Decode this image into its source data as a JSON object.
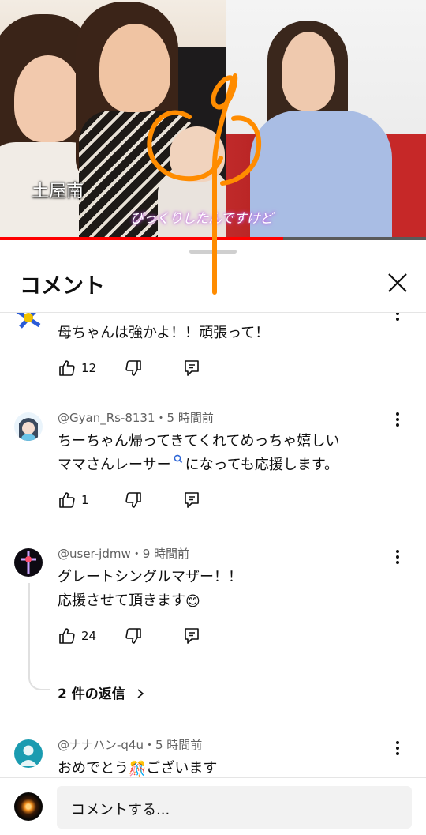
{
  "video": {
    "caption_name": "土屋南",
    "caption_sub": "びっくりしたんですけど",
    "progress": 0.665
  },
  "sheet": {
    "title": "コメント",
    "close_icon": "close-icon",
    "handle": "drag-handle"
  },
  "comments": [
    {
      "author": "",
      "text_lines": [
        "母ちゃんは強かよ！！頑張って！"
      ],
      "likes": "12",
      "avatar_icon": "flag-avatar",
      "partial": true
    },
    {
      "author": "@Gyan_Rs-8131・5 時間前",
      "text_lines": [
        "ちーちゃん帰ってきてくれてめっちゃ嬉しい",
        "ママさんレーサー",
        "になっても応援します。"
      ],
      "search_link_icon": "search-icon",
      "likes": "1",
      "avatar_icon": "anime-character-avatar"
    },
    {
      "author": "@user-jdmw・9 時間前",
      "text_lines": [
        "グレートシングルマザー！！",
        "応援させて頂きます"
      ],
      "emoji": "😊",
      "likes": "24",
      "avatar_icon": "cross-avatar",
      "replies_label": "2 件の返信"
    },
    {
      "author": "@ナナハン-q4u・5 時間前",
      "text_lines": [
        "おめでとう",
        "ございます"
      ],
      "emoji": "🎊",
      "avatar_icon": "default-person-avatar"
    }
  ],
  "bottom": {
    "input_placeholder": "コメントする..."
  },
  "colors": {
    "progress": "#ff0000",
    "doodle": "#ff8c00",
    "default_avatar": "#1a9bb0",
    "text": "#0f0f0f",
    "meta": "#606060"
  }
}
